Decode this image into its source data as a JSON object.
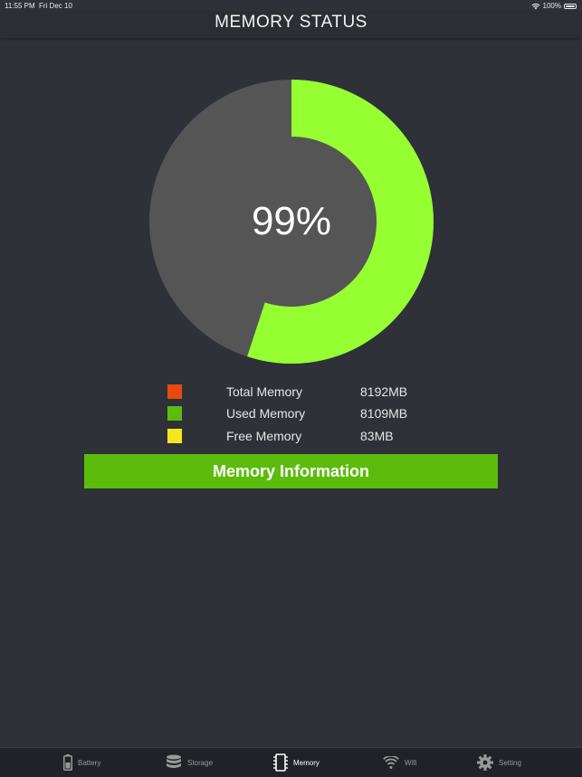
{
  "status_bar": {
    "time": "11:55 PM",
    "date": "Fri Dec 10",
    "battery": "100%"
  },
  "nav": {
    "title": "MEMORY STATUS"
  },
  "gauge": {
    "percent_label": "99%",
    "used_fraction": 0.99
  },
  "legend": [
    {
      "label": "Total Memory",
      "value": "8192MB",
      "color": "#e64a0f"
    },
    {
      "label": "Used Memory",
      "value": "8109MB",
      "color": "#5cbc0c"
    },
    {
      "label": "Free Memory",
      "value": "83MB",
      "color": "#f6e61e"
    }
  ],
  "colors": {
    "used": "#96ff32",
    "free": "#555555",
    "button": "#5cbc0c",
    "background": "#2f3139"
  },
  "button": {
    "label": "Memory Information"
  },
  "tabs": [
    {
      "label": "Battery",
      "icon": "battery-icon",
      "active": false
    },
    {
      "label": "Storage",
      "icon": "storage-icon",
      "active": false
    },
    {
      "label": "Memory",
      "icon": "memory-chip-icon",
      "active": true
    },
    {
      "label": "Wifi",
      "icon": "wifi-icon",
      "active": false
    },
    {
      "label": "Setting",
      "icon": "gear-icon",
      "active": false
    }
  ]
}
